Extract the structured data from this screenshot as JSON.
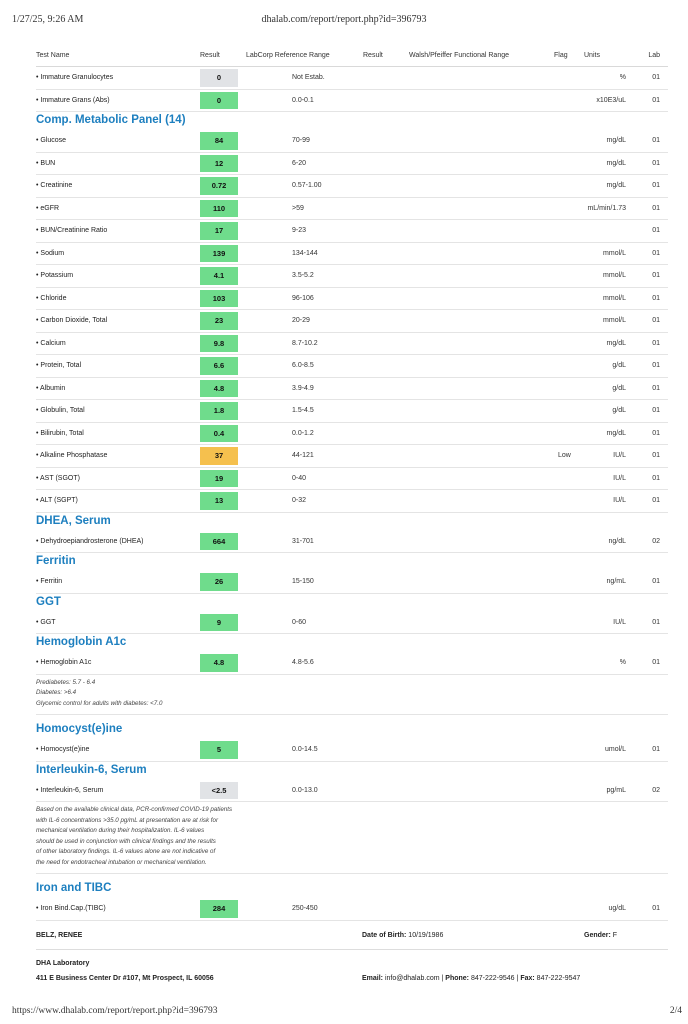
{
  "page": {
    "timestamp": "1/27/25, 9:26 AM",
    "url_top": "dhalab.com/report/report.php?id=396793",
    "url_bottom": "https://www.dhalab.com/report/report.php?id=396793",
    "page_number": "2/4"
  },
  "headers": {
    "test_name": "Test Name",
    "result": "Result",
    "labcorp_range": "LabCorp Reference Range",
    "result2": "Result",
    "walsh_range": "Walsh/Pfeiffer Functional Range",
    "flag": "Flag",
    "units": "Units",
    "lab": "Lab"
  },
  "rows_cbc": [
    {
      "name": "• Immature Granulocytes",
      "result": "0",
      "status": "gray",
      "ref": "Not Estab.",
      "flag": "",
      "units": "%",
      "lab": "01"
    },
    {
      "name": "• Immature Grans (Abs)",
      "result": "0",
      "status": "green",
      "ref": "0.0-0.1",
      "flag": "",
      "units": "x10E3/uL",
      "lab": "01"
    }
  ],
  "sections": {
    "cmp": "Comp. Metabolic Panel (14)",
    "dhea": "DHEA, Serum",
    "ferritin": "Ferritin",
    "ggt": "GGT",
    "a1c": "Hemoglobin A1c",
    "homocysteine": "Homocyst(e)ine",
    "il6": "Interleukin-6, Serum",
    "iron": "Iron and TIBC"
  },
  "rows_cmp": [
    {
      "name": "• Glucose",
      "result": "84",
      "status": "green",
      "ref": "70-99",
      "flag": "",
      "units": "mg/dL",
      "lab": "01"
    },
    {
      "name": "• BUN",
      "result": "12",
      "status": "green",
      "ref": "6-20",
      "flag": "",
      "units": "mg/dL",
      "lab": "01"
    },
    {
      "name": "• Creatinine",
      "result": "0.72",
      "status": "green",
      "ref": "0.57-1.00",
      "flag": "",
      "units": "mg/dL",
      "lab": "01"
    },
    {
      "name": "• eGFR",
      "result": "110",
      "status": "green",
      "ref": ">59",
      "flag": "",
      "units": "mL/min/1.73",
      "lab": "01"
    },
    {
      "name": "• BUN/Creatinine Ratio",
      "result": "17",
      "status": "green",
      "ref": "9-23",
      "flag": "",
      "units": "",
      "lab": "01"
    },
    {
      "name": "• Sodium",
      "result": "139",
      "status": "green",
      "ref": "134-144",
      "flag": "",
      "units": "mmol/L",
      "lab": "01"
    },
    {
      "name": "• Potassium",
      "result": "4.1",
      "status": "green",
      "ref": "3.5-5.2",
      "flag": "",
      "units": "mmol/L",
      "lab": "01"
    },
    {
      "name": "• Chloride",
      "result": "103",
      "status": "green",
      "ref": "96-106",
      "flag": "",
      "units": "mmol/L",
      "lab": "01"
    },
    {
      "name": "• Carbon Dioxide, Total",
      "result": "23",
      "status": "green",
      "ref": "20-29",
      "flag": "",
      "units": "mmol/L",
      "lab": "01"
    },
    {
      "name": "• Calcium",
      "result": "9.8",
      "status": "green",
      "ref": "8.7-10.2",
      "flag": "",
      "units": "mg/dL",
      "lab": "01"
    },
    {
      "name": "• Protein, Total",
      "result": "6.6",
      "status": "green",
      "ref": "6.0-8.5",
      "flag": "",
      "units": "g/dL",
      "lab": "01"
    },
    {
      "name": "• Albumin",
      "result": "4.8",
      "status": "green",
      "ref": "3.9-4.9",
      "flag": "",
      "units": "g/dL",
      "lab": "01"
    },
    {
      "name": "• Globulin, Total",
      "result": "1.8",
      "status": "green",
      "ref": "1.5-4.5",
      "flag": "",
      "units": "g/dL",
      "lab": "01"
    },
    {
      "name": "• Bilirubin, Total",
      "result": "0.4",
      "status": "green",
      "ref": "0.0-1.2",
      "flag": "",
      "units": "mg/dL",
      "lab": "01"
    },
    {
      "name": "• Alkaline Phosphatase",
      "result": "37",
      "status": "orange",
      "ref": "44-121",
      "flag": "Low",
      "units": "IU/L",
      "lab": "01"
    },
    {
      "name": "• AST (SGOT)",
      "result": "19",
      "status": "green",
      "ref": "0-40",
      "flag": "",
      "units": "IU/L",
      "lab": "01"
    },
    {
      "name": "• ALT (SGPT)",
      "result": "13",
      "status": "green",
      "ref": "0-32",
      "flag": "",
      "units": "IU/L",
      "lab": "01"
    }
  ],
  "rows_dhea": [
    {
      "name": "• Dehydroepiandrosterone (DHEA)",
      "result": "664",
      "status": "green",
      "ref": "31-701",
      "flag": "",
      "units": "ng/dL",
      "lab": "02"
    }
  ],
  "rows_ferritin": [
    {
      "name": "• Ferritin",
      "result": "26",
      "status": "green",
      "ref": "15-150",
      "flag": "",
      "units": "ng/mL",
      "lab": "01"
    }
  ],
  "rows_ggt": [
    {
      "name": "• GGT",
      "result": "9",
      "status": "green",
      "ref": "0-60",
      "flag": "",
      "units": "IU/L",
      "lab": "01"
    }
  ],
  "rows_a1c": [
    {
      "name": "• Hemoglobin A1c",
      "result": "4.8",
      "status": "green",
      "ref": "4.8-5.6",
      "flag": "",
      "units": "%",
      "lab": "01"
    }
  ],
  "a1c_note": [
    "Prediabetes: 5.7 - 6.4",
    "Diabetes: >6.4",
    "Glycemic control for adults with diabetes: <7.0"
  ],
  "rows_homocysteine": [
    {
      "name": "• Homocyst(e)ine",
      "result": "5",
      "status": "green",
      "ref": "0.0-14.5",
      "flag": "",
      "units": "umol/L",
      "lab": "01"
    }
  ],
  "rows_il6": [
    {
      "name": "• Interleukin-6, Serum",
      "result": "<2.5",
      "status": "gray",
      "ref": "0.0-13.0",
      "flag": "",
      "units": "pg/mL",
      "lab": "02"
    }
  ],
  "il6_note": [
    "Based on the available clinical data, PCR-confirmed COVID-19 patients",
    "with IL-6 concentrations >35.0 pg/mL at presentation are at risk for",
    "mechanical ventilation during their hospitalization. IL-6 values",
    "should be used in conjunction with clinical findings and the results",
    "of other laboratory findings. IL-6 values alone are not indicative of",
    "the need for endotracheal intubation or mechanical ventilation."
  ],
  "rows_iron": [
    {
      "name": "• Iron Bind.Cap.(TIBC)",
      "result": "284",
      "status": "green",
      "ref": "250-450",
      "flag": "",
      "units": "ug/dL",
      "lab": "01"
    }
  ],
  "patient": {
    "name": "BELZ, RENEE",
    "dob_label": "Date of Birth:",
    "dob": "10/19/1986",
    "gender_label": "Gender:",
    "gender": "F"
  },
  "lab_info": {
    "name": "DHA Laboratory",
    "address": "411 E Business Center Dr #107, Mt Prospect, IL 60056",
    "email_label": "Email:",
    "email": "info@dhalab.com",
    "phone_label": "Phone:",
    "phone": "847-222-9546",
    "fax_label": "Fax:",
    "fax": "847-222-9547",
    "sep": "|"
  },
  "colors": {
    "normal": "#6fdc8c",
    "low": "#f5c04e",
    "not_established": "#e1e3e6",
    "section_title": "#1d7fbf"
  }
}
